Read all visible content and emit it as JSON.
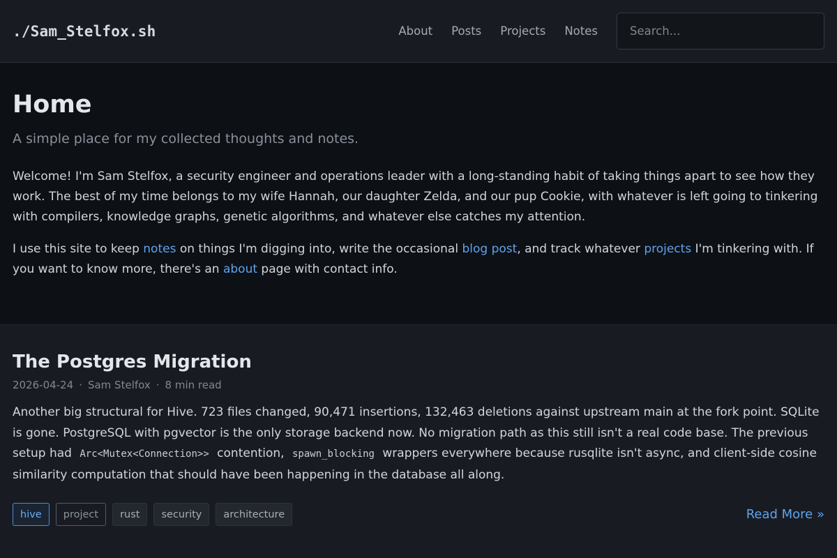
{
  "header": {
    "logo": "./Sam_Stelfox.sh",
    "nav": [
      "About",
      "Posts",
      "Projects",
      "Notes"
    ],
    "search_placeholder": "Search..."
  },
  "hero": {
    "title": "Home",
    "subtitle": "A simple place for my collected thoughts and notes.",
    "welcome": "Welcome! I'm Sam Stelfox, a security engineer and operations leader with a long-standing habit of taking things apart to see how they work. The best of my time belongs to my wife Hannah, our daughter Zelda, and our pup Cookie, with whatever is left going to tinkering with compilers, knowledge graphs, genetic algorithms, and whatever else catches my attention.",
    "intro": {
      "t1": "I use this site to keep ",
      "link_notes": "notes",
      "t2": " on things I'm digging into, write the occasional ",
      "link_blog": "blog post",
      "t3": ", and track whatever ",
      "link_projects": "projects",
      "t4": " I'm tinkering with. If you want to know more, there's an ",
      "link_about": "about",
      "t5": " page with contact info."
    }
  },
  "post": {
    "title": "The Postgres Migration",
    "date": "2026-04-24",
    "author": "Sam Stelfox",
    "read_time": "8 min read",
    "separator": "·",
    "excerpt": {
      "t1": "Another big structural for Hive. 723 files changed, 90,471 insertions, 132,463 deletions against upstream main at the fork point. SQLite is gone. PostgreSQL with pgvector is the only storage backend now. No migration path as this still isn't a real code base. The previous setup had ",
      "code1": "Arc<Mutex<Connection>>",
      "t2": " contention, ",
      "code2": "spawn_blocking",
      "t3": " wrappers everywhere because rusqlite isn't async, and client-side cosine similarity computation that should have been happening in the database all along."
    },
    "tags": [
      "hive",
      "project",
      "rust",
      "security",
      "architecture"
    ],
    "read_more": "Read More »"
  },
  "colors": {
    "link": "#5fa3ee",
    "header_bg": "#181c22",
    "hero_bg": "#0d1014",
    "card_bg": "#181c22"
  }
}
